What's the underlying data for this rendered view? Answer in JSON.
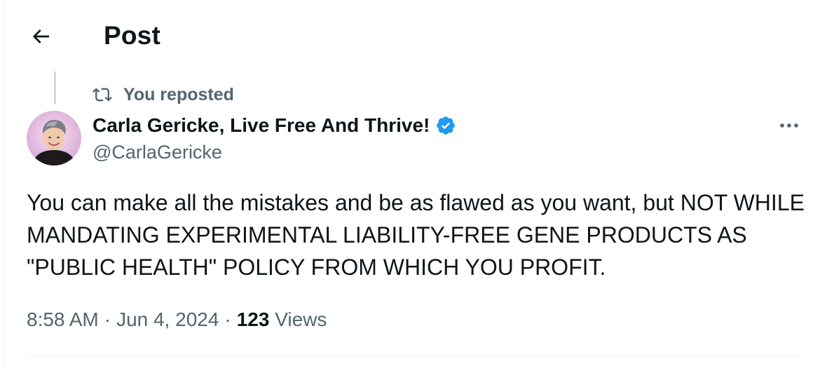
{
  "header": {
    "title": "Post",
    "back_icon": "arrow-left-icon"
  },
  "repost": {
    "icon": "repost-icon",
    "label": "You reposted"
  },
  "author": {
    "name": "Carla Gericke, Live Free And Thrive!",
    "handle": "@CarlaGericke",
    "verified": true,
    "verified_color": "#1d9bf0"
  },
  "post": {
    "text": "You can make all the mistakes and be as flawed as you want, but NOT WHILE MANDATING EXPERIMENTAL LIABILITY-FREE GENE PRODUCTS AS \"PUBLIC HEALTH\" POLICY FROM WHICH YOU PROFIT.",
    "time": "8:58 AM",
    "separator": "·",
    "date": "Jun 4, 2024",
    "views_count": "123",
    "views_label": "Views"
  },
  "colors": {
    "text_primary": "#0f1419",
    "text_secondary": "#536471",
    "divider": "#eff3f4",
    "thread_line": "#cfd9de"
  }
}
